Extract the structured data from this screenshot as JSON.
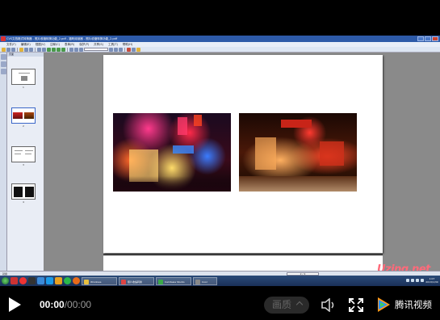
{
  "window": {
    "title": "CVS文档格式转换器 - 照片收缩转换功能_2.pdf - 福昕阅读器 - 照片收缩转换功能_2.pdf"
  },
  "menu": {
    "items": [
      "文件(F)",
      "编辑(E)",
      "视图(V)",
      "注释(C)",
      "表单(R)",
      "保护(P)",
      "共享(S)",
      "工具(T)",
      "帮助(H)"
    ]
  },
  "sidebar": {
    "header": "页面",
    "thumb_numbers": [
      "1",
      "2",
      "3",
      "4"
    ],
    "selected_index": 2
  },
  "status": {
    "left": "就绪",
    "page": "2 / 4"
  },
  "taskbar": {
    "buttons": [
      "Windows",
      "照片收缩转换",
      "Camtasia Studio",
      "Cool"
    ],
    "clock_time": "1:07",
    "clock_date": "2013/1/30"
  },
  "watermark": "Uzing.net",
  "player": {
    "current_time": "00:00",
    "separator": "/",
    "total_time": "00:00",
    "quality_label": "画质",
    "brand_name": "腾讯视频"
  },
  "colors": {
    "accent": "#2d5aa8",
    "brand_orange": "#ff9a1a",
    "brand_green": "#3ecf5a",
    "brand_blue": "#2a8fff"
  }
}
